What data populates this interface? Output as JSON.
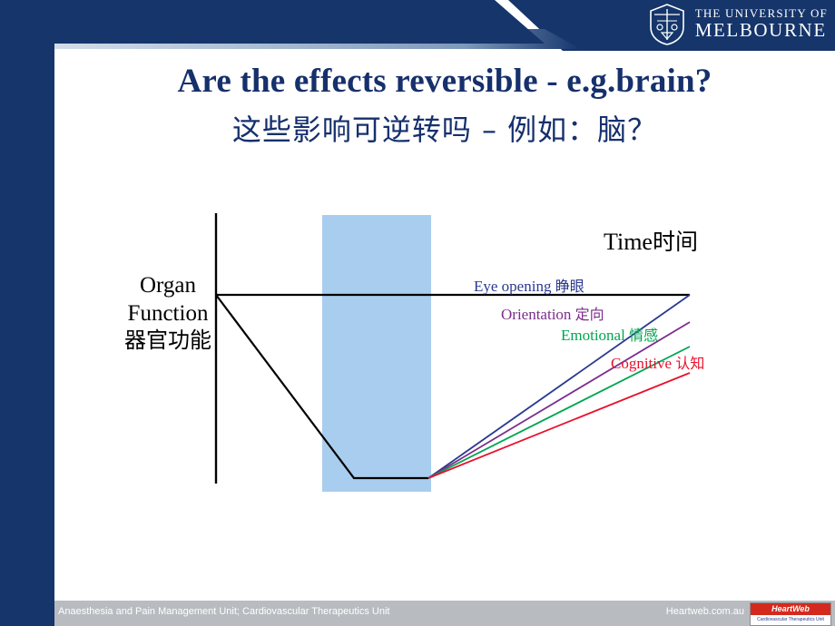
{
  "branding": {
    "university_line1": "THE UNIVERSITY OF",
    "university_line2": "MELBOURNE",
    "crest_icon": "university-crest-icon"
  },
  "title": {
    "english": "Are the effects reversible - e.g.brain?",
    "chinese": "这些影响可逆转吗 – 例如：脑？"
  },
  "chart_data": {
    "type": "line",
    "title": "",
    "ylabel_lines": [
      "Organ",
      "Function"
    ],
    "ylabel_chinese": "器官功能",
    "xlabel": "Time时间",
    "xlabel_english": "Time",
    "xlabel_chinese": "时间",
    "annotations": [
      {
        "label_english": "Eye opening",
        "label_chinese": "睁眼",
        "color": "#2b3990"
      },
      {
        "label_english": "Orientation",
        "label_chinese": "定向",
        "color": "#7b2d8b"
      },
      {
        "label_english": "Emotional",
        "label_chinese": "情感",
        "color": "#00a651"
      },
      {
        "label_english": "Cognitive",
        "label_chinese": "认知",
        "color": "#e8112d"
      }
    ],
    "shaded_band": {
      "name": "anaesthesia-period",
      "color": "#a8cdee"
    },
    "baseline_curve_color": "#000000",
    "grid": false,
    "legend": "inline-annotations"
  },
  "footer": {
    "left_text": "Anaesthesia and Pain Management Unit; Cardiovascular Therapeutics Unit",
    "right_text": "Heartweb.com.au",
    "logo_top": "HeartWeb",
    "logo_bottom": "Cardiovascular Therapeutics Unit"
  },
  "colors": {
    "navy": "#15356b",
    "title_blue": "#16306c",
    "band_blue": "#a8cdee",
    "footer_grey": "#b8bcc0"
  }
}
